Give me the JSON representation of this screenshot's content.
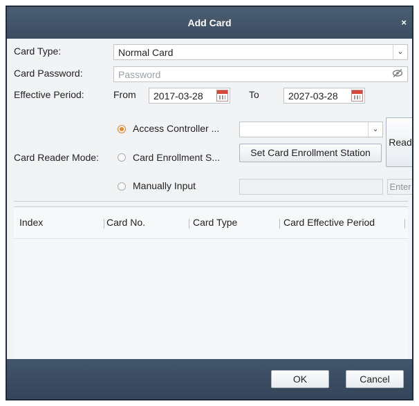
{
  "dialog": {
    "title": "Add Card",
    "close_glyph": "×"
  },
  "form": {
    "card_type_label": "Card Type:",
    "card_type_value": "Normal Card",
    "password_label": "Card Password:",
    "password_placeholder": "Password",
    "effective_label": "Effective Period:",
    "from_label": "From",
    "from_date": "2017-03-28",
    "to_label": "To",
    "to_date": "2027-03-28",
    "reader_mode_label": "Card Reader Mode:",
    "modes": [
      {
        "label": "Access Controller ...",
        "selected": true
      },
      {
        "label": "Card Enrollment S...",
        "selected": false
      },
      {
        "label": "Manually Input",
        "selected": false
      }
    ],
    "controller_select_value": "",
    "set_station_button": "Set Card Enrollment Station",
    "read_button": "Read",
    "manual_input_value": "",
    "enter_button": "Enter"
  },
  "table": {
    "columns": [
      "Index",
      "Card No.",
      "Card Type",
      "Card Effective Period"
    ],
    "rows": []
  },
  "footer": {
    "ok_button": "OK",
    "cancel_button": "Cancel"
  },
  "icons": {
    "dropdown": "chevron-down-icon",
    "password_visibility": "eye-slash-icon",
    "calendar": "calendar-icon",
    "close": "close-icon"
  },
  "colors": {
    "titlebar": "#43556a",
    "radio_selected": "#e58a2c",
    "calendar_accent": "#d24a3c"
  }
}
